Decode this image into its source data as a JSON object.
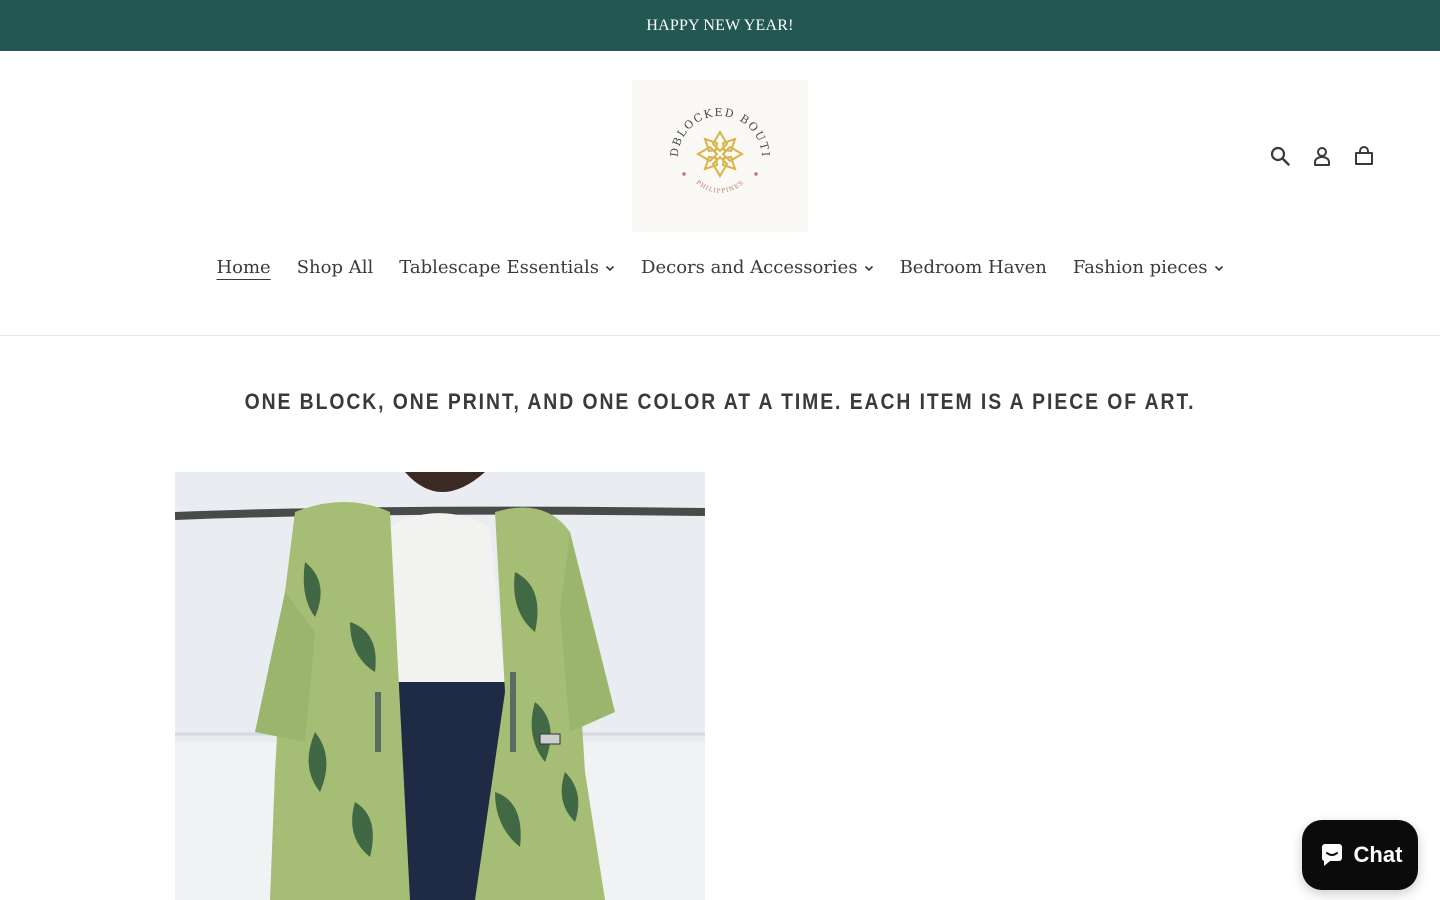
{
  "announcement": {
    "text": "HAPPY NEW YEAR!",
    "background": "#225753"
  },
  "logo": {
    "arc_text": "HANDBLOCKED BOUTIQUE",
    "sub_text": "PHILIPPINES",
    "gold": "#d6b44a",
    "text_color": "#4a4a4a"
  },
  "header": {
    "icons": [
      "search-icon",
      "account-icon",
      "cart-icon"
    ]
  },
  "nav": {
    "items": [
      {
        "label": "Home",
        "active": true,
        "dropdown": false
      },
      {
        "label": "Shop All",
        "active": false,
        "dropdown": false
      },
      {
        "label": "Tablescape Essentials",
        "active": false,
        "dropdown": true
      },
      {
        "label": "Decors and Accessories",
        "active": false,
        "dropdown": true
      },
      {
        "label": "Bedroom Haven",
        "active": false,
        "dropdown": false
      },
      {
        "label": "Fashion pieces",
        "active": false,
        "dropdown": true
      }
    ]
  },
  "tagline": "ONE BLOCK, ONE PRINT, AND ONE COLOR AT A TIME. EACH ITEM IS A PIECE OF ART.",
  "chat": {
    "label": "Chat",
    "icon": "chat-bubble-icon"
  }
}
